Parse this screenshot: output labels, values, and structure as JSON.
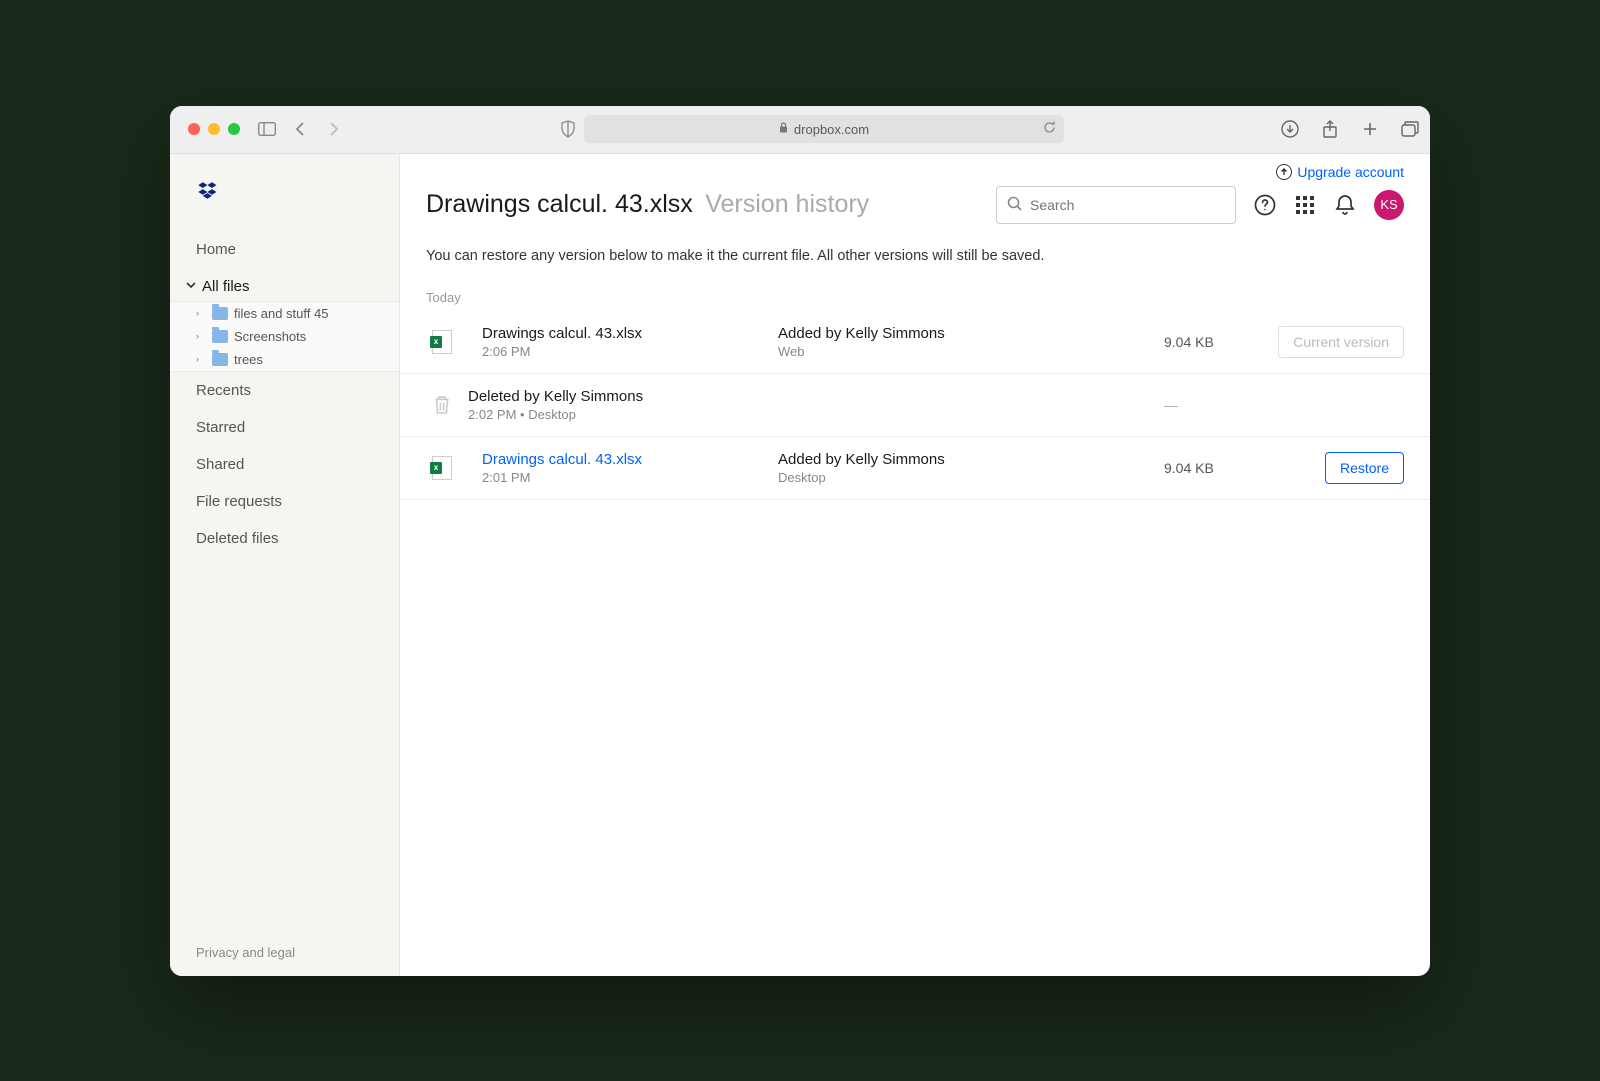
{
  "browser": {
    "url_host": "dropbox.com"
  },
  "upgrade": {
    "label": "Upgrade account"
  },
  "sidebar": {
    "home": "Home",
    "all_files": "All files",
    "folders": [
      {
        "name": "files and stuff 45"
      },
      {
        "name": "Screenshots"
      },
      {
        "name": "trees"
      }
    ],
    "recents": "Recents",
    "starred": "Starred",
    "shared": "Shared",
    "file_requests": "File requests",
    "deleted_files": "Deleted files",
    "footer": "Privacy and legal"
  },
  "header": {
    "title": "Drawings calcul. 43.xlsx",
    "subtitle": "Version history",
    "search_placeholder": "Search",
    "avatar_initials": "KS"
  },
  "restore_note": "You can restore any version below to make it the current file. All other versions will still be saved.",
  "section_label": "Today",
  "versions": [
    {
      "type": "file",
      "name": "Drawings calcul. 43.xlsx",
      "time": "2:06 PM",
      "added_by": "Added by Kelly Simmons",
      "source": "Web",
      "size": "9.04 KB",
      "action_label": "Current version",
      "is_current": true
    },
    {
      "type": "deleted",
      "text": "Deleted by Kelly Simmons",
      "meta": "2:02 PM • Desktop",
      "size": "—"
    },
    {
      "type": "file",
      "name": "Drawings calcul. 43.xlsx",
      "time": "2:01 PM",
      "added_by": "Added by Kelly Simmons",
      "source": "Desktop",
      "size": "9.04 KB",
      "action_label": "Restore",
      "is_current": false
    }
  ]
}
